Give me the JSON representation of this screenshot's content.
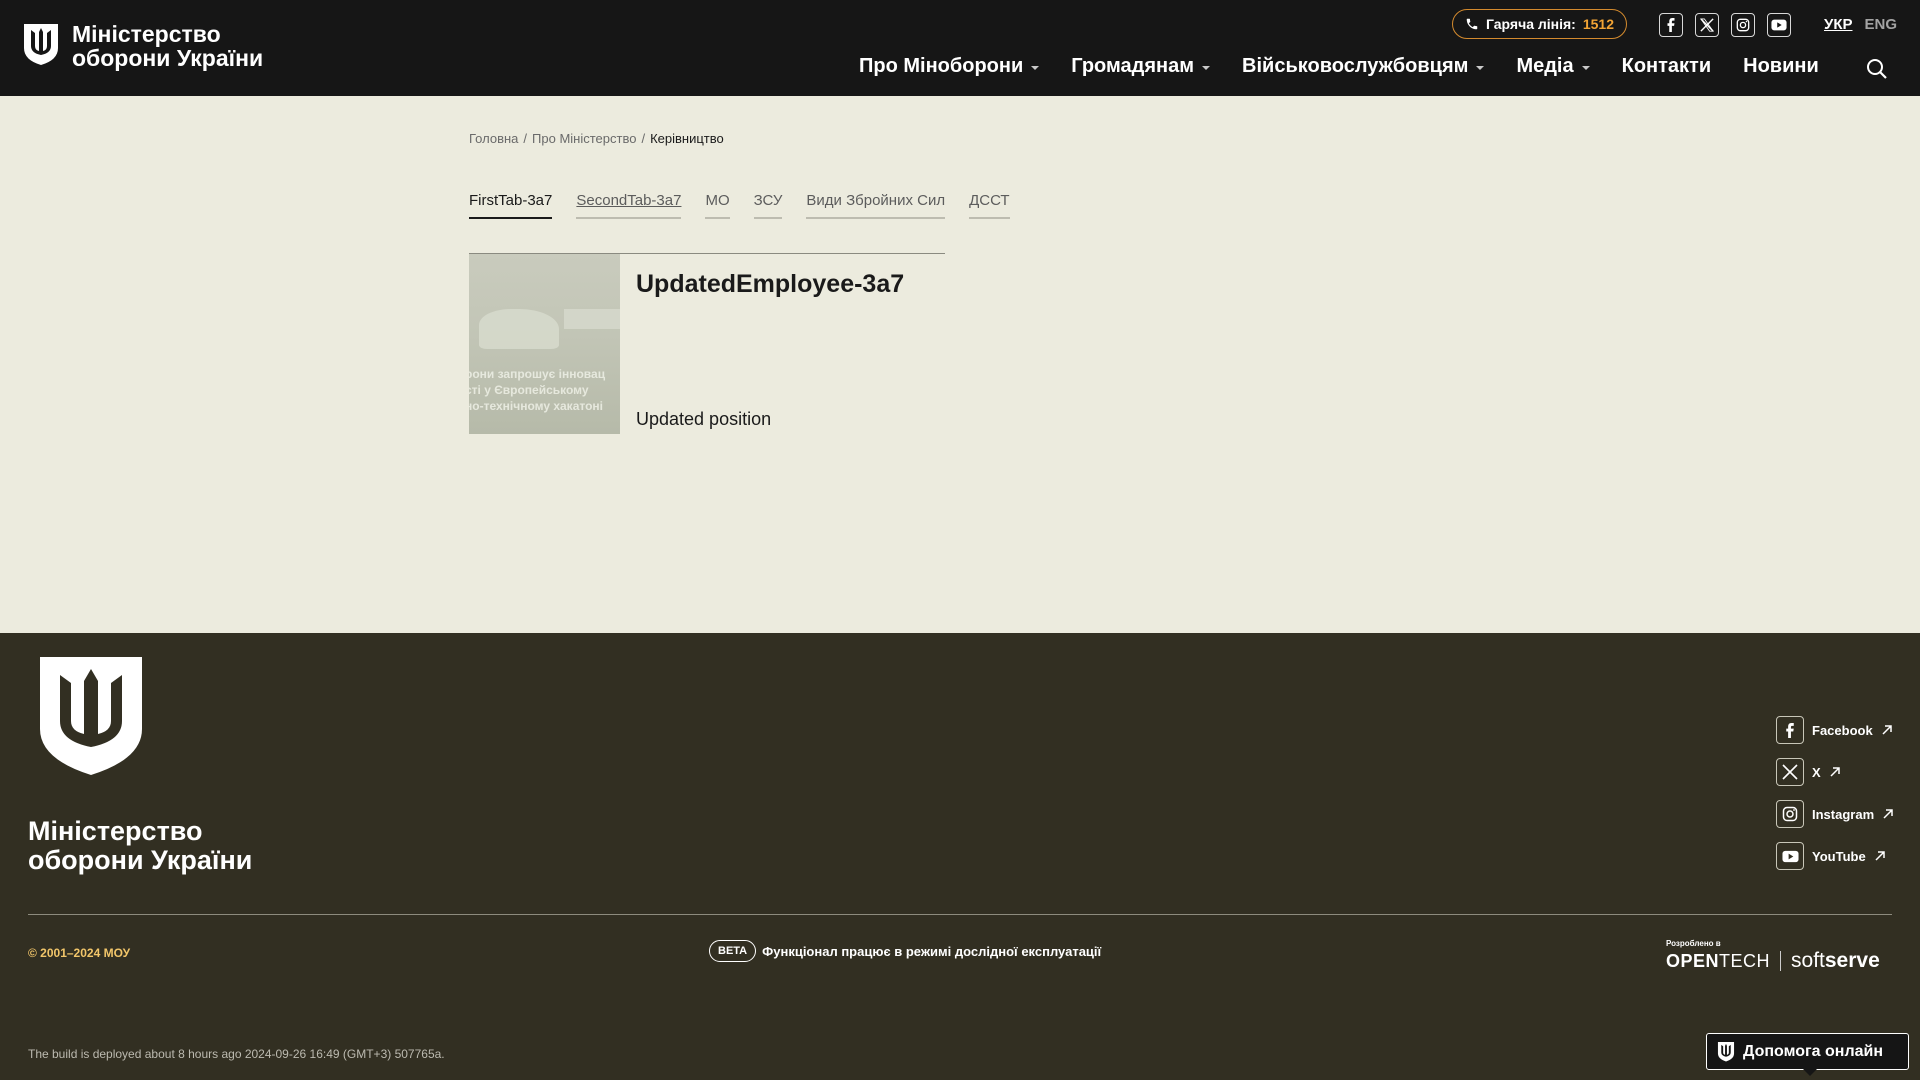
{
  "header": {
    "logo_line1": "Міністерство",
    "logo_line2": "оборони України",
    "hotline_label": "Гаряча лінія:",
    "hotline_number": "1512",
    "lang_active": "УКР",
    "lang_other": "ENG",
    "nav": [
      {
        "label": "Про Міноборони",
        "dropdown": true
      },
      {
        "label": "Громадянам",
        "dropdown": true
      },
      {
        "label": "Військовослужбовцям",
        "dropdown": true
      },
      {
        "label": "Медіа",
        "dropdown": true
      },
      {
        "label": "Контакти",
        "dropdown": false
      },
      {
        "label": "Новини",
        "dropdown": false
      }
    ]
  },
  "breadcrumb": {
    "items": [
      "Головна",
      "Про Міністерство",
      "Керівництво"
    ],
    "separator": "/"
  },
  "tabs": [
    "FirstTab-3a7",
    "SecondTab-3a7",
    "МО",
    "ЗСУ",
    "Види Збройних Сил",
    "ДССТ"
  ],
  "employee": {
    "name": "UpdatedEmployee-3a7",
    "position": "Updated position",
    "image_text": [
      "рони запрошує інновац",
      "сті у Європейському",
      "но-технічному хакатоні"
    ]
  },
  "footer": {
    "title_line1": "Міністерство",
    "title_line2": "оборони України",
    "socials": [
      "Facebook",
      "X",
      "Instagram",
      "YouTube"
    ],
    "copyright": "© 2001–2024 МОУ",
    "beta_badge": "BETA",
    "beta_text": "Функціонал працює в режимі дослідної експлуатації",
    "developed_by": "Розроблено в",
    "dev_brand1_bold": "OPEN",
    "dev_brand1_light": "TECH",
    "dev_brand2_light": "soft",
    "dev_brand2_bold": "serve",
    "build_info": "The build is deployed about 8 hours ago 2024-09-26 16:49 (GMT+3) 507765a."
  },
  "help_button": "Допомога онлайн",
  "colors": {
    "header_bg": "#161616",
    "page_bg": "#ecebde",
    "footer_bg": "#322f22",
    "accent": "#f2a435"
  }
}
